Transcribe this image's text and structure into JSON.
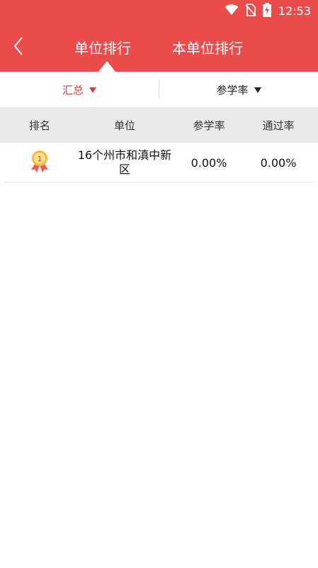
{
  "status_bar": {
    "time": "12:53",
    "icons": [
      "wifi-icon",
      "no-sim-icon",
      "battery-charging-icon"
    ]
  },
  "header": {
    "back_icon": "chevron-left-icon",
    "tabs": [
      {
        "label": "单位排行",
        "active": true
      },
      {
        "label": "本单位排行",
        "active": false
      }
    ]
  },
  "filters": {
    "summary": {
      "label": "汇总",
      "icon": "caret-down-icon"
    },
    "rate": {
      "label": "参学率",
      "icon": "caret-down-icon"
    }
  },
  "table": {
    "columns": [
      "排名",
      "单位",
      "参学率",
      "通过率"
    ],
    "rows": [
      {
        "rank_icon": "rank-1-medal-icon",
        "rank_number": "1",
        "unit": "16个州市和滇中新区",
        "participation_rate": "0.00%",
        "pass_rate": "0.00%"
      }
    ]
  },
  "colors": {
    "header_red": "#ea4b4b",
    "active_filter_red": "#e0393b",
    "table_header_gray": "#e9e9e9"
  }
}
